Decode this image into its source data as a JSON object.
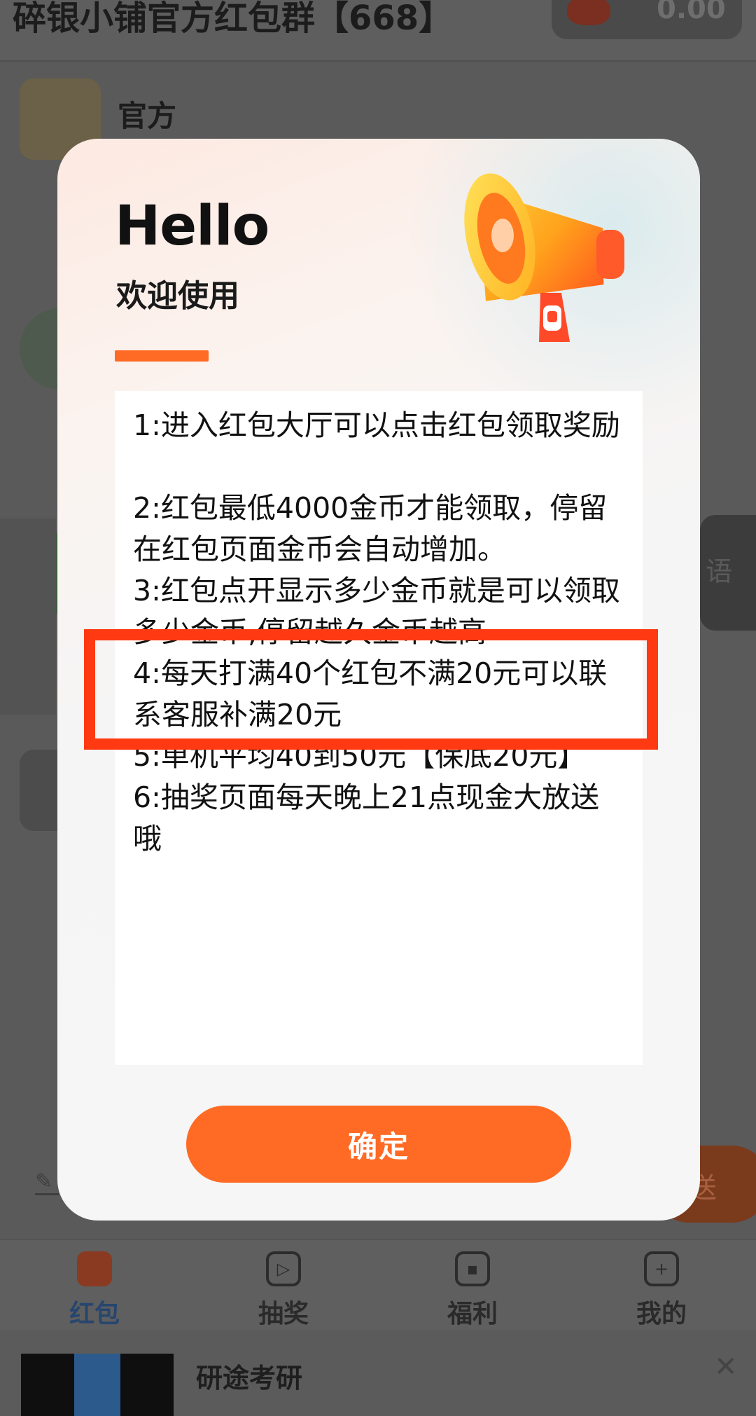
{
  "background": {
    "group_title": "碎银小铺官方红包群【668】",
    "balance": "0.00",
    "official_sender": "官方",
    "side_tag": "语",
    "fab_label": "送"
  },
  "modal": {
    "greeting": "Hello",
    "subtitle": "欢迎使用",
    "rules": [
      "1:进入红包大厅可以点击红包领取奖励",
      "2:红包最低4000金币才能领取，停留在红包页面金币会自动增加。",
      "3:红包点开显示多少金币就是可以领取多少金币,停留越久金币越高",
      "4:每天打满40个红包不满20元可以联系客服补满20元",
      "5:单机平均40到50元【保底20元】",
      "6:抽奖页面每天晚上21点现金大放送哦"
    ],
    "confirm_label": "确定",
    "accent_color": "#ff6a24",
    "highlight_color": "#ff3a12"
  },
  "tabbar": {
    "tabs": [
      {
        "label": "红包",
        "icon": "red-envelope-icon",
        "active": true
      },
      {
        "label": "抽奖",
        "icon": "play-icon",
        "active": false
      },
      {
        "label": "福利",
        "icon": "tv-icon",
        "active": false
      },
      {
        "label": "我的",
        "icon": "profile-icon",
        "active": false
      }
    ]
  },
  "ad": {
    "title": "研途考研"
  }
}
